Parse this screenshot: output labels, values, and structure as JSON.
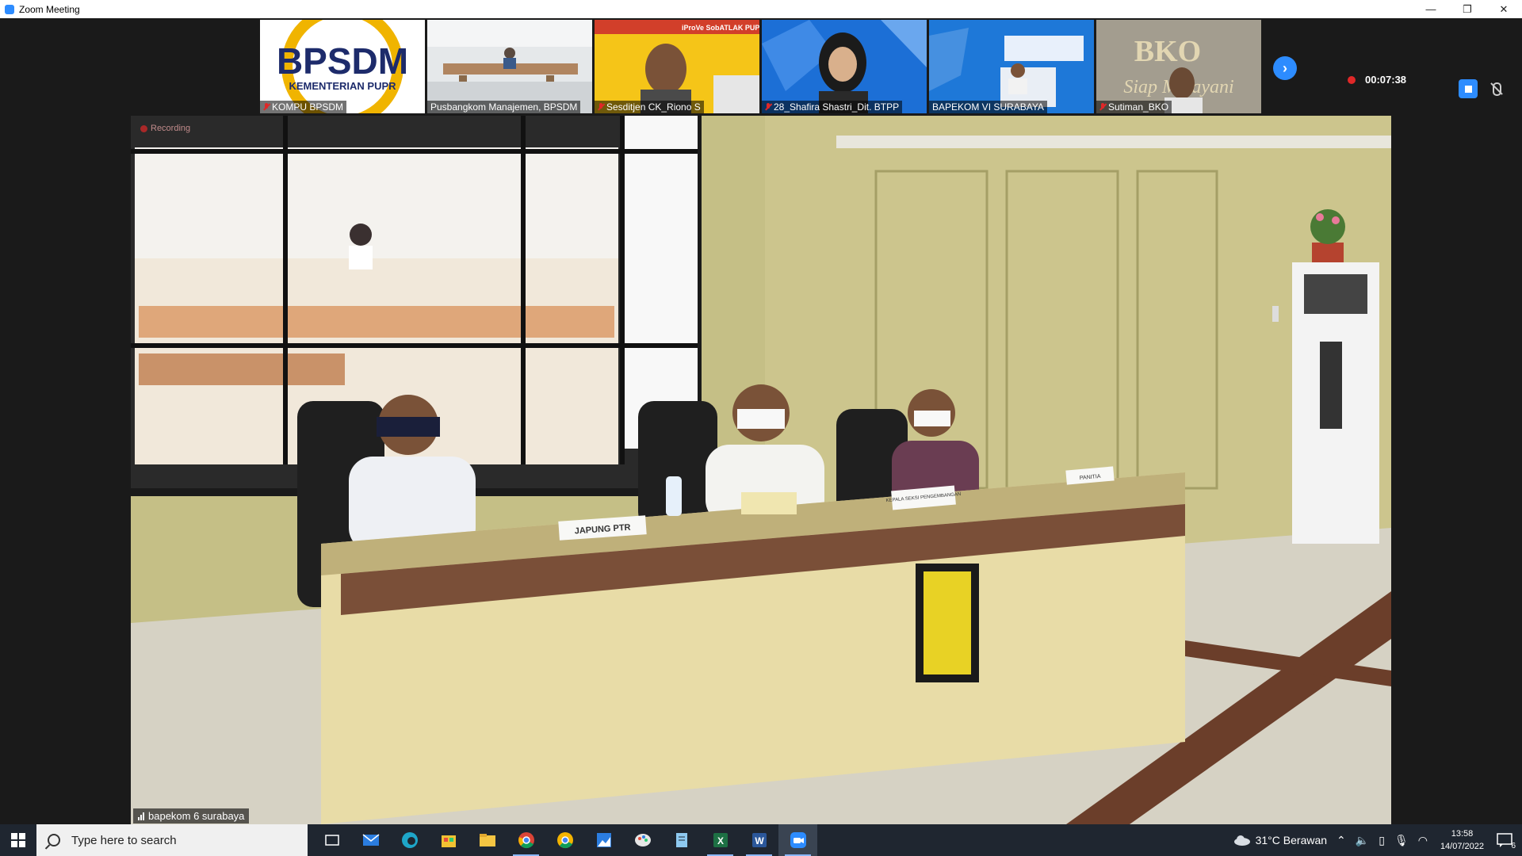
{
  "window": {
    "title": "Zoom Meeting",
    "controls": [
      "—",
      "❐",
      "✕"
    ]
  },
  "participants": [
    {
      "name": "KOMPU BPSDM",
      "muted": true,
      "bg": "#ffffff",
      "logo_text": "BPSDM",
      "logo_sub": "KEMENTERIAN PUPR"
    },
    {
      "name": "Pusbangkom Manajemen, BPSDM",
      "muted": false,
      "bg": "#dfe4e8"
    },
    {
      "name": "Sesditjen CK_Riono S",
      "muted": true,
      "bg": "#f5c518",
      "banner": "iProVe  SobATLAK  PUPR"
    },
    {
      "name": "28_Shafira Shastri_Dit. BTPP",
      "muted": true,
      "bg": "#1c6fd6"
    },
    {
      "name": "BAPEKOM VI SURABAYA",
      "muted": false,
      "bg": "#1e78d8"
    },
    {
      "name": "Sutiman_BKO",
      "muted": true,
      "bg": "#a09a8c",
      "logo_text": "BKO",
      "logo_sub": "Siap Melayani"
    }
  ],
  "recording": {
    "elapsed": "00:07:38"
  },
  "main_video": {
    "speaker": "bapekom 6 surabaya",
    "recording_label": "Recording",
    "desk_labels": [
      "JAPUNG PTR",
      "KEPALA SEKSI PENGEMBANGAN",
      "PANITIA"
    ]
  },
  "taskbar": {
    "search_placeholder": "Type here to search",
    "apps": [
      "task-view",
      "mail",
      "edge",
      "store",
      "file-explorer",
      "chrome",
      "chrome-alt",
      "photos",
      "paint",
      "notepad",
      "excel",
      "word",
      "zoom"
    ],
    "weather": "31°C  Berawan",
    "time": "13:58",
    "date": "14/07/2022",
    "notifications": "6"
  }
}
